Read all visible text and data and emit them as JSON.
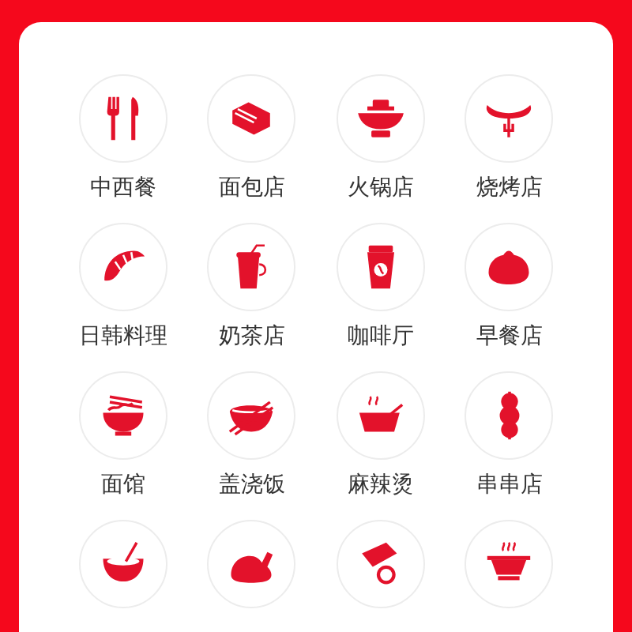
{
  "categories": [
    {
      "kind": "category",
      "label": "中西餐"
    },
    {
      "kind": "category",
      "label": "面包店"
    },
    {
      "kind": "category",
      "label": "火锅店"
    },
    {
      "kind": "category",
      "label": "烧烤店"
    },
    {
      "kind": "category",
      "label": "日韩料理"
    },
    {
      "kind": "category",
      "label": "奶茶店"
    },
    {
      "kind": "category",
      "label": "咖啡厅"
    },
    {
      "kind": "category",
      "label": "早餐店"
    },
    {
      "kind": "category",
      "label": "面馆"
    },
    {
      "kind": "category",
      "label": "盖浇饭"
    },
    {
      "kind": "category",
      "label": "麻辣烫"
    },
    {
      "kind": "category",
      "label": "串串店"
    },
    {
      "kind": "category"
    },
    {
      "kind": "category"
    },
    {
      "kind": "category"
    },
    {
      "kind": "category"
    }
  ]
}
